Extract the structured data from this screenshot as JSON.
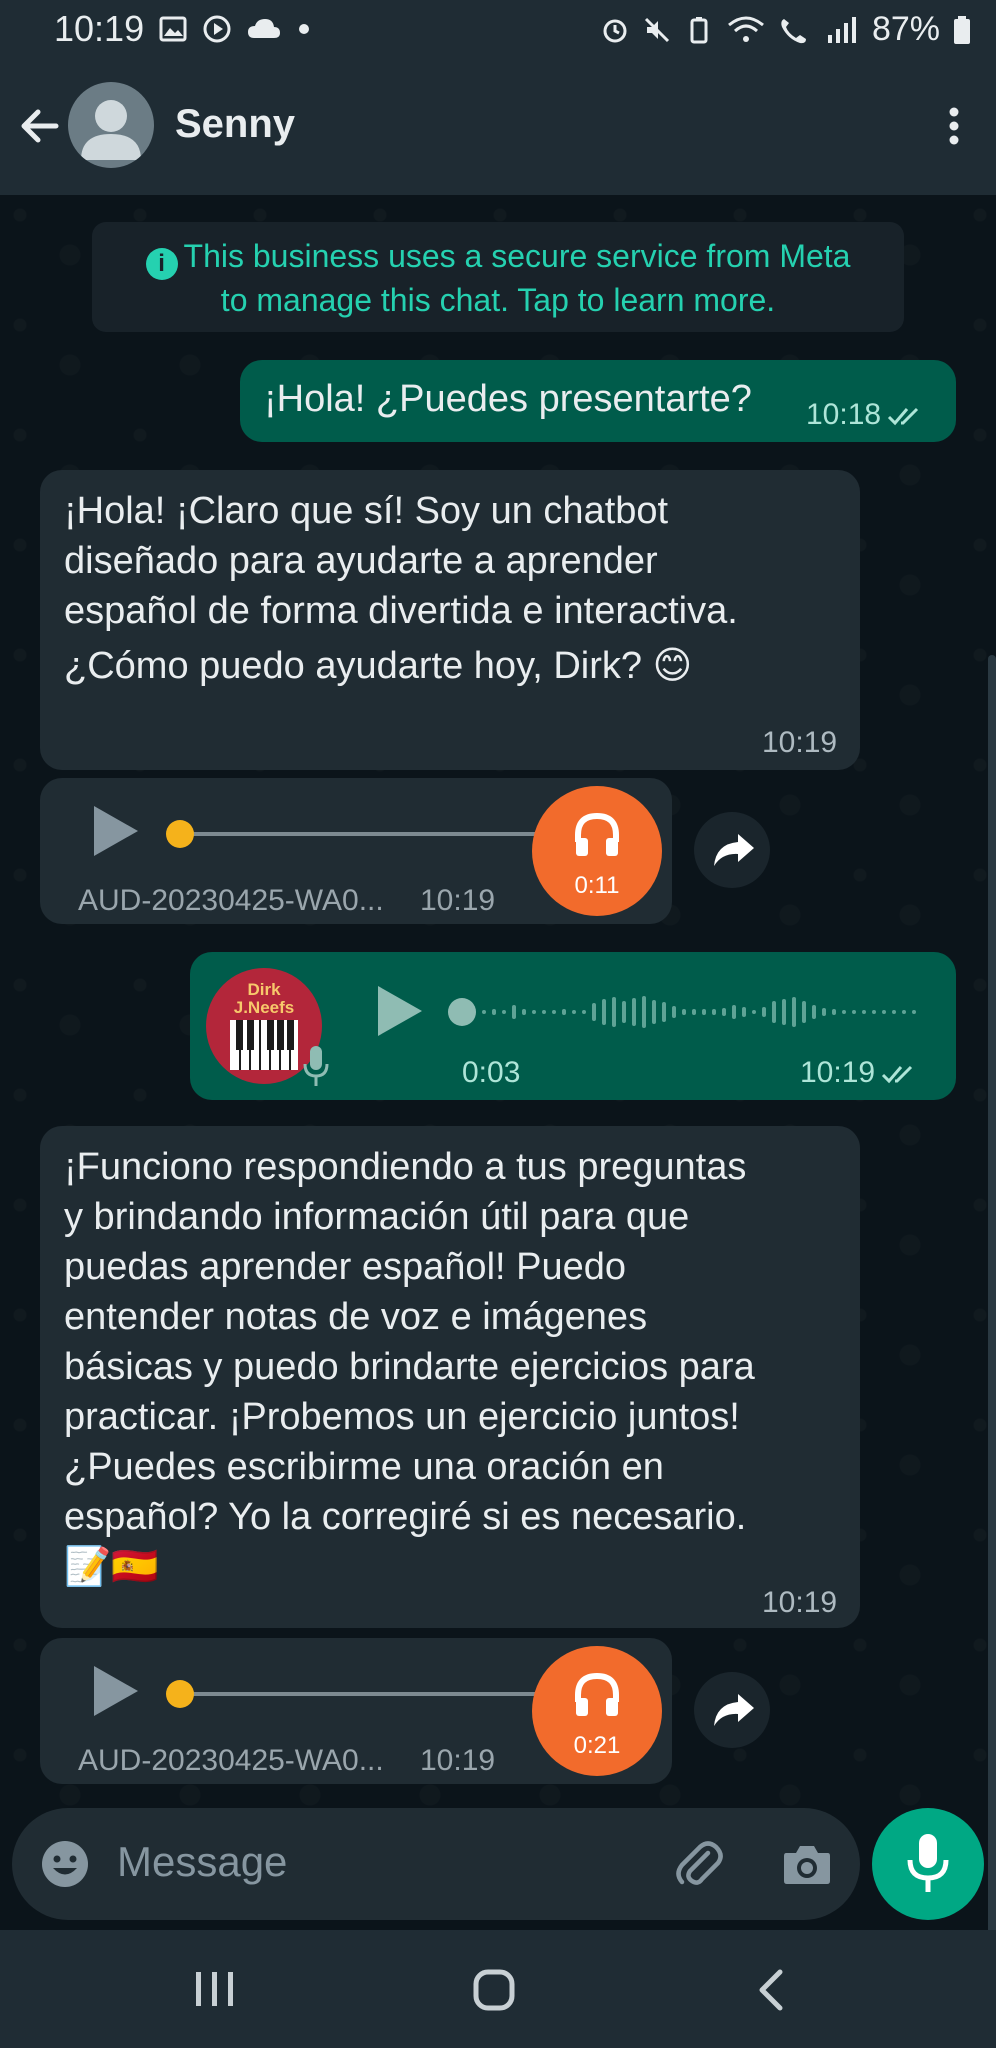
{
  "status_bar": {
    "time": "10:19",
    "battery": "87%"
  },
  "header": {
    "contact_name": "Senny"
  },
  "notice": {
    "line1": "This business uses a secure service from Meta",
    "line2": "to manage this chat. Tap to learn more."
  },
  "messages": [
    {
      "type": "text",
      "direction": "outgoing",
      "text": "¡Hola! ¿Puedes presentarte?",
      "time": "10:18"
    },
    {
      "type": "text",
      "direction": "incoming",
      "lines": [
        "¡Hola! ¡Claro que sí! Soy un chatbot",
        "diseñado para ayudarte a aprender",
        "español de forma divertida e interactiva.",
        "¿Cómo puedo ayudarte hoy, Dirk? 😊"
      ],
      "time": "10:19"
    },
    {
      "type": "audio",
      "direction": "incoming",
      "file_name": "AUD-20230425-WA0...",
      "time": "10:19",
      "duration": "0:11",
      "progress": 0
    },
    {
      "type": "voice",
      "direction": "outgoing",
      "avatar_text": [
        "Dirk",
        "J.Neefs"
      ],
      "duration": "0:03",
      "time": "10:19"
    },
    {
      "type": "text",
      "direction": "incoming",
      "lines": [
        "¡Funciono respondiendo a tus preguntas",
        "y brindando información útil para que",
        "puedas aprender español! Puedo",
        "entender notas de voz e imágenes",
        "básicas y puedo brindarte ejercicios para",
        "practicar. ¡Probemos un ejercicio juntos!",
        "¿Puedes escribirme una oración en",
        "español? Yo la corregiré si es necesario.",
        "📝🇪🇸"
      ],
      "time": "10:19"
    },
    {
      "type": "audio",
      "direction": "incoming",
      "file_name": "AUD-20230425-WA0...",
      "time": "10:19",
      "duration": "0:21",
      "progress": 0
    }
  ],
  "input": {
    "placeholder": "Message"
  },
  "icons": {
    "back": "arrow-left-icon",
    "menu": "more-vertical-icon",
    "emoji": "emoji-icon",
    "attach": "paperclip-icon",
    "camera": "camera-icon",
    "mic": "microphone-icon",
    "headphones": "headphones-icon",
    "forward": "forward-icon",
    "play": "play-icon"
  },
  "colors": {
    "accent": "#00a884",
    "outgoing_bubble": "#005c4b",
    "incoming_bubble": "#202c33",
    "audio_badge": "#f26b2c",
    "progress_dot": "#f5b21b"
  }
}
